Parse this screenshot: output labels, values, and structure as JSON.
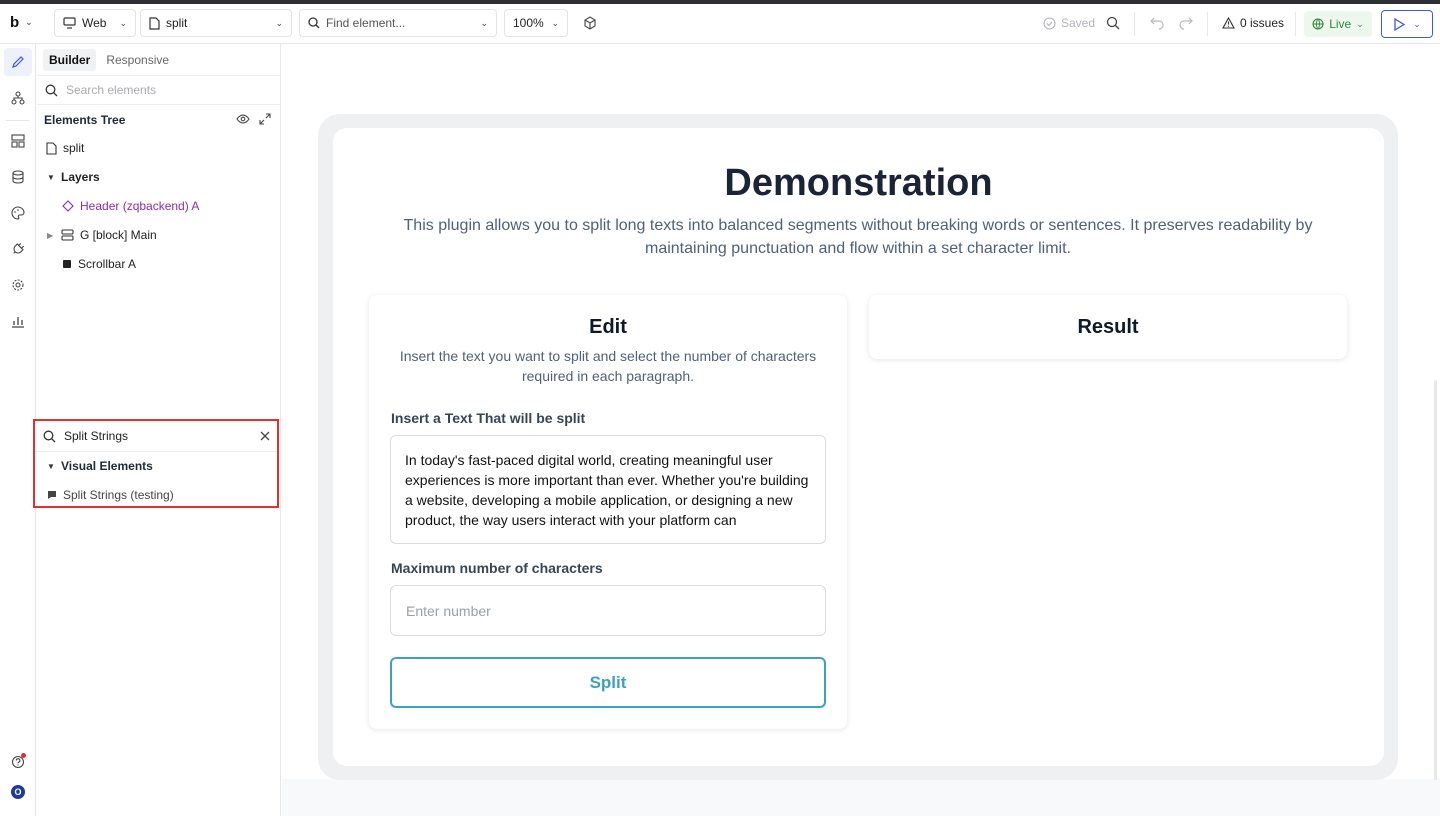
{
  "app": {
    "logo": "b",
    "platform": "Web",
    "page_name": "split",
    "find_placeholder": "Find element...",
    "zoom": "100%",
    "saved_label": "Saved",
    "issues_label": "0 issues",
    "live_label": "Live"
  },
  "rail": {
    "items": [
      "pencil-icon",
      "hierarchy-icon",
      "layout-icon",
      "database-icon",
      "palette-icon",
      "plug-icon",
      "settings-icon",
      "chart-icon"
    ],
    "avatar_letter": "O"
  },
  "panel": {
    "tabs": [
      "Builder",
      "Responsive"
    ],
    "search_placeholder": "Search elements",
    "tree_title": "Elements Tree",
    "page_item": "split",
    "layers_label": "Layers",
    "layers": [
      {
        "label": "Header (zqbackend) A"
      },
      {
        "label": "G [block] Main"
      },
      {
        "label": "Scrollbar A"
      }
    ]
  },
  "search_results": {
    "query": "Split Strings",
    "group_label": "Visual Elements",
    "item_label": "Split Strings (testing)"
  },
  "demo": {
    "title": "Demonstration",
    "subtitle": "This plugin allows you to split long texts into balanced segments without breaking words or sentences. It preserves readability by maintaining punctuation and flow within a set character limit.",
    "edit": {
      "title": "Edit",
      "subtitle": "Insert the text you want to split and select the number of characters required in each paragraph.",
      "text_label": "Insert a Text That will be split",
      "text_value": "In today's fast-paced digital world, creating meaningful user experiences is more important than ever. Whether you're building a website, developing a mobile application, or designing a new product, the way users interact with your platform can",
      "number_label": "Maximum number of characters",
      "number_placeholder": "Enter number",
      "button_label": "Split"
    },
    "result": {
      "title": "Result"
    }
  },
  "colors": {
    "accent": "#3b5bdb",
    "split_button": "#3aa3c0",
    "highlight_border": "#e03131",
    "live_green": "#2f8a3a",
    "layer_purple": "#8a2bb0"
  }
}
